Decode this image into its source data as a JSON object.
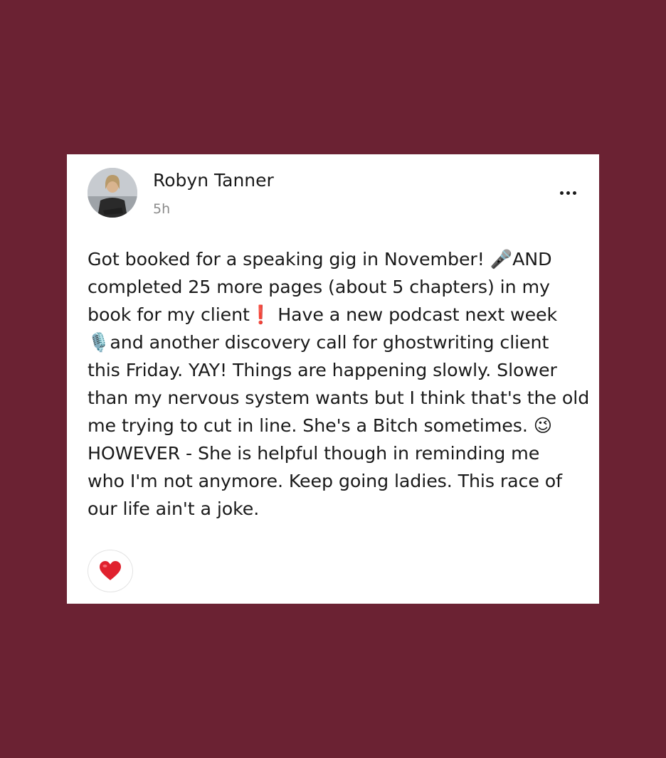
{
  "post": {
    "author": "Robyn Tanner",
    "time": "5h",
    "lines": [
      "Got booked for a speaking gig in November! 🎤AND",
      "completed 25 more pages (about 5 chapters) in my",
      "book for my client❗ Have a new podcast next week",
      "🎙️and  another discovery call for ghostwriting client",
      "this Friday. YAY! Things are happening slowly. Slower",
      "than my nervous system wants but I think that's the old",
      "me trying to cut in line. She's a Bitch sometimes. 😉",
      "HOWEVER - She is helpful though in reminding me",
      "who I'm not anymore. Keep going ladies. This race of",
      "our life ain't a joke."
    ]
  },
  "actions": {
    "more_icon": "more-horizontal-icon",
    "reaction_icon": "heart-icon",
    "reaction_color": "#e0212e"
  },
  "colors": {
    "background": "#6b2233",
    "card": "#ffffff",
    "text": "#1a1a1a",
    "muted": "#8a8a8a"
  }
}
